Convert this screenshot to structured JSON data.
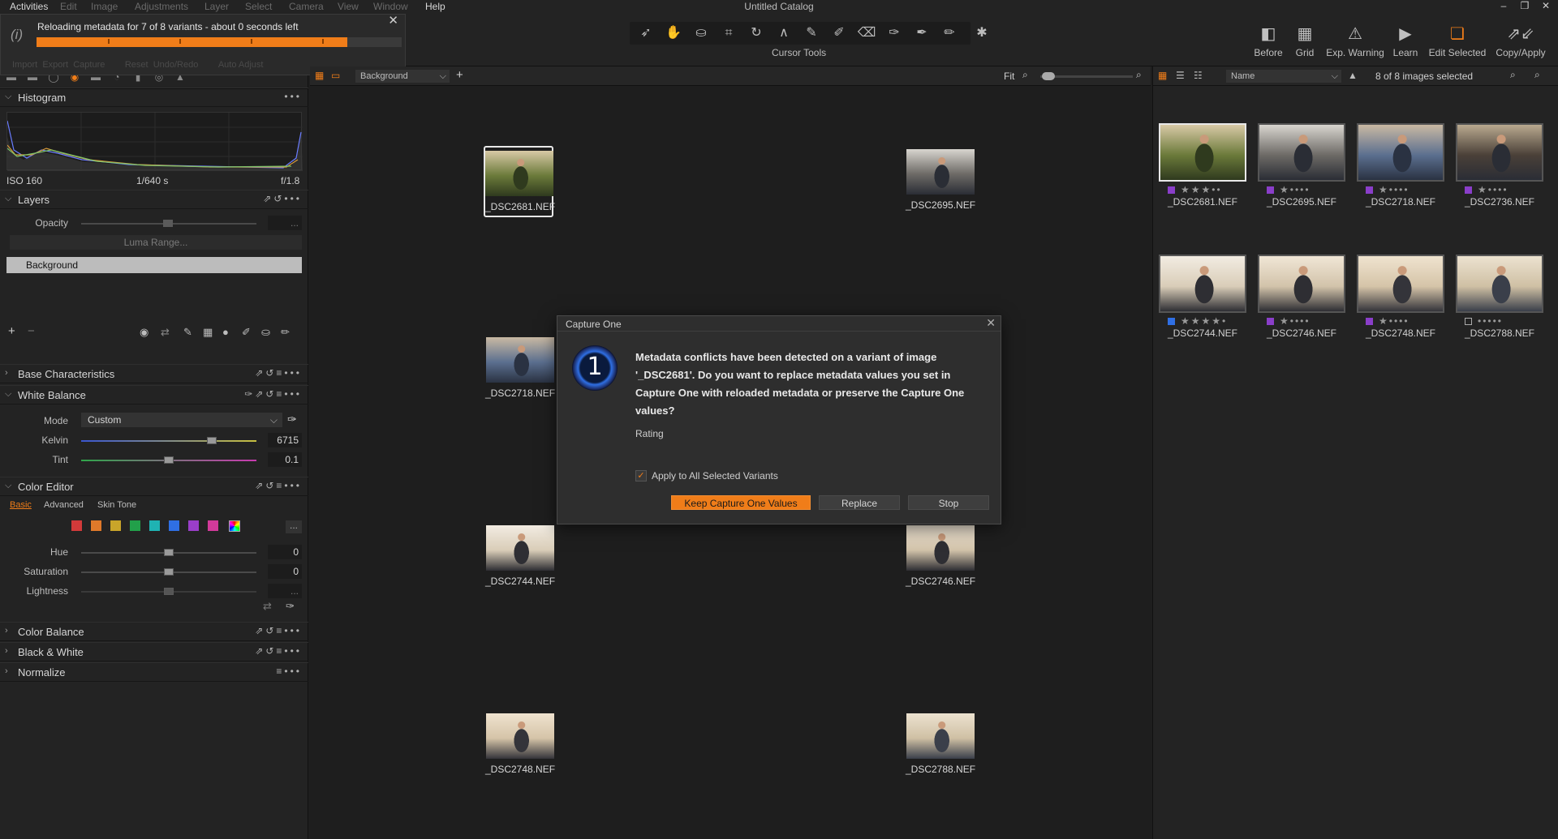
{
  "window": {
    "title": "Untitled Catalog",
    "controls": [
      "–",
      "❐",
      "✕"
    ]
  },
  "menu": {
    "activities": "Activities",
    "items": [
      "Edit",
      "Image",
      "Adjustments",
      "Layer",
      "Select",
      "Camera",
      "View",
      "Window",
      "Help"
    ]
  },
  "activities_popup": {
    "message": "Reloading metadata for 7 of 8 variants - about 0 seconds left",
    "progress": 0.85,
    "hidden_row": [
      "Import",
      "Export",
      "Capture",
      "Reset",
      "Undo/Redo",
      "Auto Adjust"
    ]
  },
  "toolbar": {
    "cursor_tools_label": "Cursor Tools",
    "cursor_tool_icons": [
      "pointer-icon",
      "hand-icon",
      "stamp-icon",
      "crop-icon",
      "rotate-icon",
      "keystone-icon",
      "brush-icon",
      "pencil-icon",
      "eraser-icon",
      "picker-icon",
      "gradient-icon",
      "erase-icon",
      "magic-icon"
    ],
    "right": [
      {
        "label": "Before",
        "icon": "before-icon"
      },
      {
        "label": "Grid",
        "icon": "grid-icon"
      },
      {
        "label": "Exp. Warning",
        "icon": "warning-icon"
      },
      {
        "label": "Learn",
        "icon": "play-icon"
      },
      {
        "label": "Edit Selected",
        "icon": "edit-selected-icon"
      },
      {
        "label": "Copy/Apply",
        "icon": "copy-apply-icon"
      }
    ]
  },
  "histogram": {
    "title": "Histogram",
    "iso": "ISO 160",
    "shutter": "1/640 s",
    "aperture": "f/1.8"
  },
  "layers": {
    "title": "Layers",
    "opacity_label": "Opacity",
    "opacity_value": "...",
    "luma_range": "Luma Range...",
    "background_layer": "Background"
  },
  "sections": {
    "base_characteristics": "Base Characteristics",
    "white_balance": "White Balance",
    "color_editor": "Color Editor",
    "color_balance": "Color Balance",
    "black_white": "Black & White",
    "normalize": "Normalize"
  },
  "white_balance": {
    "mode_label": "Mode",
    "mode_value": "Custom",
    "kelvin_label": "Kelvin",
    "kelvin_value": "6715",
    "tint_label": "Tint",
    "tint_value": "0.1"
  },
  "color_editor": {
    "tabs": [
      "Basic",
      "Advanced",
      "Skin Tone"
    ],
    "active_tab": "Basic",
    "swatches": [
      "#d23a3a",
      "#e0792a",
      "#c9a52a",
      "#22a04a",
      "#1fb3b3",
      "#2f6fe4",
      "#9a3ec9",
      "#d23a9a"
    ],
    "more": "...",
    "hue_label": "Hue",
    "hue_value": "0",
    "saturation_label": "Saturation",
    "saturation_value": "0",
    "lightness_label": "Lightness",
    "lightness_value": "..."
  },
  "viewer": {
    "layer_select": "Background",
    "zoom": "Fit",
    "thumbs": [
      {
        "name": "_DSC2681.NEF",
        "palette": [
          "#6b7a3a",
          "#2f3a1e",
          "#d8c9a6"
        ]
      },
      {
        "name": "_DSC2695.NEF",
        "palette": [
          "#6d6a66",
          "#2a2d35",
          "#d8d5cf"
        ]
      },
      {
        "name": "_DSC2718.NEF",
        "palette": [
          "#5b6f8f",
          "#2a3242",
          "#c9b9a3"
        ]
      },
      {
        "name": "_DSC2744.NEF",
        "palette": [
          "#d9cdb8",
          "#2e2e33",
          "#f2ece2"
        ]
      },
      {
        "name": "_DSC2746.NEF",
        "palette": [
          "#d2c3aa",
          "#2e2e33",
          "#f0e6d6"
        ]
      },
      {
        "name": "_DSC2748.NEF",
        "palette": [
          "#d5c4a8",
          "#34343a",
          "#efe3cf"
        ]
      },
      {
        "name": "_DSC2788.NEF",
        "palette": [
          "#cfc0a4",
          "#3a3f4a",
          "#ece2d0"
        ]
      }
    ]
  },
  "dialog": {
    "title": "Capture One",
    "logo_glyph": "1",
    "message": "Metadata conflicts have been detected on a variant of image '_DSC2681'. Do you want to replace metadata values you set in Capture One with reloaded metadata or preserve the Capture One values?",
    "field": "Rating",
    "checkbox_label": "Apply to All Selected Variants",
    "checkbox_checked": true,
    "buttons": {
      "keep": "Keep Capture One Values",
      "replace": "Replace",
      "stop": "Stop"
    }
  },
  "browser": {
    "sort_field": "Name",
    "selection_count": "8 of 8 images selected",
    "thumbs": [
      {
        "name": "_DSC2681.NEF",
        "rating": 3,
        "tag": "#8a3ec9",
        "palette": [
          "#6b7a3a",
          "#2f3a1e",
          "#d8c9a6"
        ]
      },
      {
        "name": "_DSC2695.NEF",
        "rating": 1,
        "tag": "#8a3ec9",
        "palette": [
          "#6d6a66",
          "#2a2d35",
          "#d8d5cf"
        ]
      },
      {
        "name": "_DSC2718.NEF",
        "rating": 1,
        "tag": "#8a3ec9",
        "palette": [
          "#5b6f8f",
          "#2a3242",
          "#c9b9a3"
        ]
      },
      {
        "name": "_DSC2736.NEF",
        "rating": 1,
        "tag": "#8a3ec9",
        "palette": [
          "#4a4038",
          "#2a2d35",
          "#b9a98f"
        ]
      },
      {
        "name": "_DSC2744.NEF",
        "rating": 4,
        "tag": "#2f6fe4",
        "palette": [
          "#d9cdb8",
          "#2e2e33",
          "#f2ece2"
        ]
      },
      {
        "name": "_DSC2746.NEF",
        "rating": 1,
        "tag": "#8a3ec9",
        "palette": [
          "#d2c3aa",
          "#2e2e33",
          "#f0e6d6"
        ]
      },
      {
        "name": "_DSC2748.NEF",
        "rating": 1,
        "tag": "#8a3ec9",
        "palette": [
          "#d5c4a8",
          "#34343a",
          "#efe3cf"
        ]
      },
      {
        "name": "_DSC2788.NEF",
        "rating": 0,
        "tag": "none",
        "palette": [
          "#cfc0a4",
          "#3a3f4a",
          "#ece2d0"
        ]
      }
    ]
  },
  "colors": {
    "accent": "#f07d19",
    "panel_bg": "#232323",
    "viewer_bg": "#1e1e1e"
  }
}
